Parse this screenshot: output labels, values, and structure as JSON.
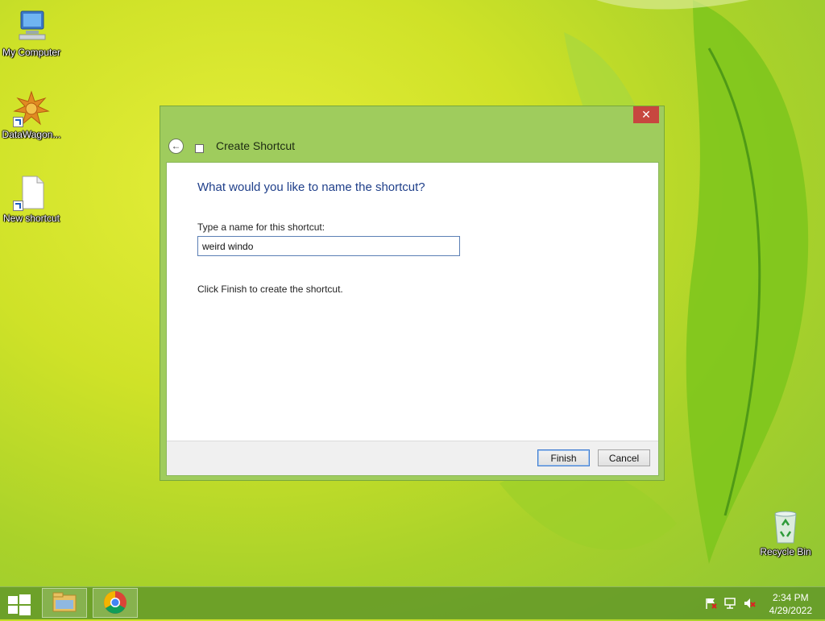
{
  "desktop": {
    "icons": [
      {
        "label": "My Computer"
      },
      {
        "label": "DataWagon..."
      },
      {
        "label": "New shortcut"
      },
      {
        "label": "Recycle Bin"
      }
    ]
  },
  "dialog": {
    "title": "Create Shortcut",
    "close_glyph": "✕",
    "back_glyph": "←",
    "question": "What would you like to name the shortcut?",
    "field_label": "Type a name for this shortcut:",
    "name_value": "weird windo",
    "hint": "Click Finish to create the shortcut.",
    "finish_label": "Finish",
    "cancel_label": "Cancel"
  },
  "taskbar": {
    "time": "2:34 PM",
    "date": "4/29/2022",
    "tray_icons": [
      "action-center-flag-icon",
      "network-icon",
      "speaker-muted-icon"
    ]
  },
  "colors": {
    "dialog_frame": "#9fcc5d",
    "close_button": "#c7473f",
    "heading_blue": "#1f3f8a",
    "taskbar": "#6a9e2c"
  }
}
